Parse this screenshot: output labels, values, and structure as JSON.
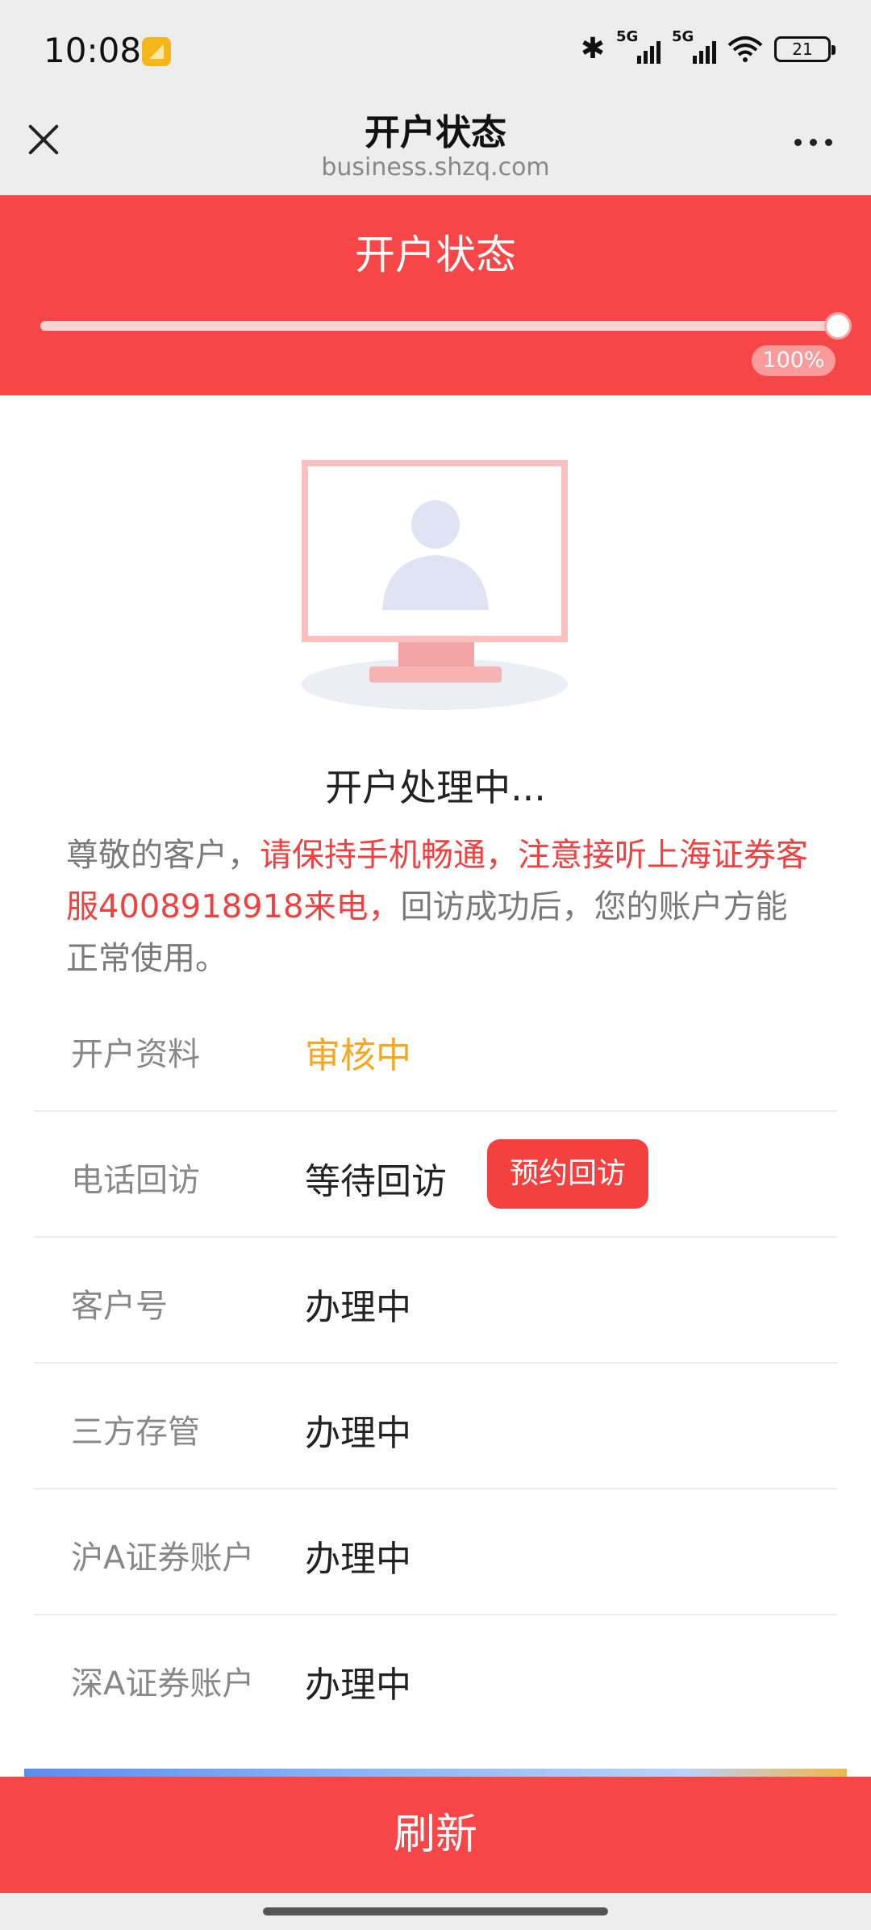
{
  "status_bar": {
    "time": "10:08",
    "signal1_tag": "5G",
    "signal2_tag": "5G",
    "battery": "21",
    "icons": [
      "notification-icon",
      "bluetooth-icon",
      "signal-icon",
      "wifi-icon",
      "battery-icon"
    ]
  },
  "titlebar": {
    "title": "开户状态",
    "url": "business.shzq.com"
  },
  "hero": {
    "title": "开户状态",
    "progress": 100,
    "progress_label": "100%"
  },
  "main": {
    "heading": "开户处理中...",
    "notice_prefix": "尊敬的客户，",
    "notice_highlight": "请保持手机畅通，注意接听上海证券客服4008918918来电，",
    "notice_suffix": "回访成功后，您的账户方能正常使用。"
  },
  "rows": [
    {
      "label": "开户资料",
      "value": "审核中"
    },
    {
      "label": "电话回访",
      "value": "等待回访",
      "button": "预约回访"
    },
    {
      "label": "客户号",
      "value": "办理中"
    },
    {
      "label": "三方存管",
      "value": "办理中"
    },
    {
      "label": "沪A证券账户",
      "value": "办理中"
    },
    {
      "label": "深A证券账户",
      "value": "办理中"
    }
  ],
  "footer": {
    "refresh_label": "刷新"
  },
  "colors": {
    "accent": "#f64648",
    "pending": "#f5a623"
  }
}
